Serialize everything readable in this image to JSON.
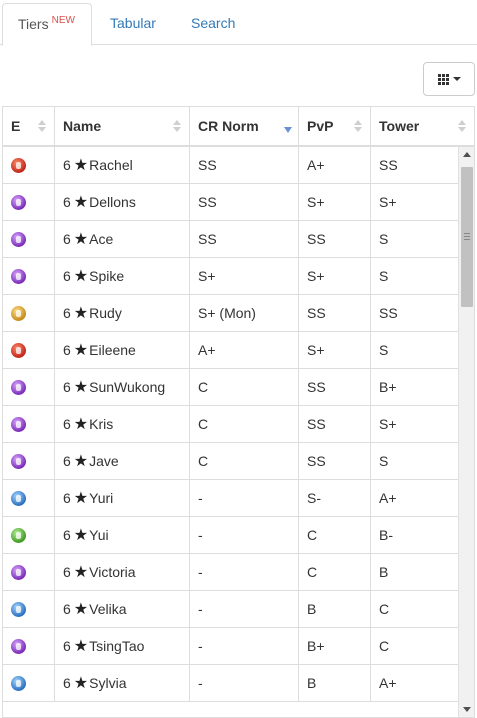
{
  "tabs": [
    {
      "label": "Tiers",
      "badge": "NEW"
    },
    {
      "label": "Tabular"
    },
    {
      "label": "Search"
    }
  ],
  "toolbar": {
    "columns_icon": "grid-icon",
    "dropdown_icon": "caret-down-icon"
  },
  "table": {
    "headers": [
      "E",
      "Name",
      "CR Norm",
      "PvP",
      "Tower"
    ],
    "sorted_column": "CR Norm",
    "star_glyph": "★",
    "rows": [
      {
        "element": "fire",
        "stars": "6",
        "name": "Rachel",
        "cr": "SS",
        "pvp": "A+",
        "tower": "SS"
      },
      {
        "element": "dark",
        "stars": "6",
        "name": "Dellons",
        "cr": "SS",
        "pvp": "S+",
        "tower": "S+"
      },
      {
        "element": "dark",
        "stars": "6",
        "name": "Ace",
        "cr": "SS",
        "pvp": "SS",
        "tower": "S"
      },
      {
        "element": "dark",
        "stars": "6",
        "name": "Spike",
        "cr": "S+",
        "pvp": "S+",
        "tower": "S"
      },
      {
        "element": "light",
        "stars": "6",
        "name": "Rudy",
        "cr": "S+ (Mon)",
        "pvp": "SS",
        "tower": "SS"
      },
      {
        "element": "fire",
        "stars": "6",
        "name": "Eileene",
        "cr": "A+",
        "pvp": "S+",
        "tower": "S"
      },
      {
        "element": "dark",
        "stars": "6",
        "name": "SunWukong",
        "cr": "C",
        "pvp": "SS",
        "tower": "B+"
      },
      {
        "element": "dark",
        "stars": "6",
        "name": "Kris",
        "cr": "C",
        "pvp": "SS",
        "tower": "S+"
      },
      {
        "element": "dark",
        "stars": "6",
        "name": "Jave",
        "cr": "C",
        "pvp": "SS",
        "tower": "S"
      },
      {
        "element": "water",
        "stars": "6",
        "name": "Yuri",
        "cr": "-",
        "pvp": "S-",
        "tower": "A+"
      },
      {
        "element": "earth",
        "stars": "6",
        "name": "Yui",
        "cr": "-",
        "pvp": "C",
        "tower": "B-"
      },
      {
        "element": "dark",
        "stars": "6",
        "name": "Victoria",
        "cr": "-",
        "pvp": "C",
        "tower": "B"
      },
      {
        "element": "water",
        "stars": "6",
        "name": "Velika",
        "cr": "-",
        "pvp": "B",
        "tower": "C"
      },
      {
        "element": "dark",
        "stars": "6",
        "name": "TsingTao",
        "cr": "-",
        "pvp": "B+",
        "tower": "C"
      },
      {
        "element": "water",
        "stars": "6",
        "name": "Sylvia",
        "cr": "-",
        "pvp": "B",
        "tower": "A+"
      }
    ]
  }
}
